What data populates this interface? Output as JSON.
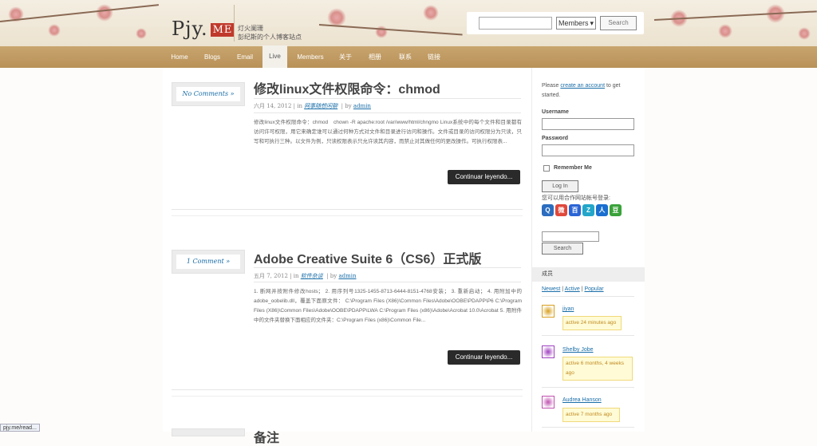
{
  "header": {
    "logo_text": "Pjy.",
    "logo_badge": "ME",
    "slogan_line1": "灯火阑珊",
    "slogan_line2": "彭纪斯的个人博客站点",
    "search_placeholder": "",
    "search_select": "Members",
    "search_button": "Search"
  },
  "nav": {
    "items": [
      {
        "label": "Home",
        "active": false
      },
      {
        "label": "Blogs",
        "active": false
      },
      {
        "label": "Email",
        "active": false
      },
      {
        "label": "Live",
        "active": true
      },
      {
        "label": "Members",
        "active": false
      },
      {
        "label": "关于",
        "active": false
      },
      {
        "label": "相册",
        "active": false
      },
      {
        "label": "联系",
        "active": false
      },
      {
        "label": "链接",
        "active": false
      }
    ]
  },
  "posts": [
    {
      "comments": "No Comments »",
      "title": "修改linux文件权限命令：chmod",
      "date": "六月 14, 2012",
      "category": "网事随想闲聊",
      "author": "admin",
      "excerpt": "修改linux文件权限命令：chmod　chown -R apache:root /var/www/html/chngmo Linux系统中的每个文件和目录都有访问许可权限，用它来确定谁可以通过何种方式对文件和目录进行访问和操作。文件或目录的访问权限分为只读，只写和可执行三种。以文件为例，只读权限表示只允许读其内容，而禁止对其做任何的更改操作。可执行权限表...",
      "more": "Continuar leyendo..."
    },
    {
      "comments": "1 Comment »",
      "title": "Adobe Creative Suite 6（CS6）正式版",
      "date": "五月 7, 2012",
      "category": "软件杂谈",
      "author": "admin",
      "excerpt": "1. 断网并按附件修改hosts； 2. 用序列号1325-1455-8713-6444-8151-4768安装； 3. 重新启动； 4. 用附加中的adobe_oobelib.dll，覆盖下面原文件： C:\\Program Files (X86)\\Common Files\\Adobe\\OOBE\\PDAPP\\P6 C:\\Program Files (X86)\\Common Files\\Adobe\\OOBE\\PDAPP\\LWA C:\\Program Files (x86)\\Adobe\\Acrobat 10.0\\Acrobat 5. 用附件中的文件夹替换下面相应的文件夹：C:\\Program Files (x86)\\Common File...",
      "more": "Continuar leyendo..."
    },
    {
      "comments": "",
      "title": "备注",
      "date": "",
      "category": "",
      "author": "",
      "excerpt": "",
      "more": ""
    }
  ],
  "sidebar": {
    "intro_prefix": "Please",
    "intro_link": "create an account",
    "intro_suffix": "to get started.",
    "username_label": "Username",
    "password_label": "Password",
    "remember_label": "Remember Me",
    "login_button": "Log In",
    "social_text": "您可以用合作网站帐号登录:",
    "socials": [
      {
        "icon": "qq-icon",
        "color": "#2b6dbf",
        "glyph": "Q"
      },
      {
        "icon": "weibo-icon",
        "color": "#e0483c",
        "glyph": "微"
      },
      {
        "icon": "baidu-icon",
        "color": "#2a64d5",
        "glyph": "百"
      },
      {
        "icon": "qzone-icon",
        "color": "#23a6c9",
        "glyph": "Z"
      },
      {
        "icon": "renren-icon",
        "color": "#1a6fd0",
        "glyph": "人"
      },
      {
        "icon": "douban-icon",
        "color": "#3aa23a",
        "glyph": "豆"
      }
    ],
    "search_button": "Search",
    "members_heading": "成员",
    "member_tabs": [
      "Newest",
      "Active",
      "Popular"
    ],
    "members": [
      {
        "name": "jiyan",
        "activity": "active 24 minutes ago",
        "avatar_color": "#d9a020"
      },
      {
        "name": "Shelby Jobe",
        "activity": "active 6 months, 4 weeks ago",
        "avatar_color": "#a040c0"
      },
      {
        "name": "Audrea Hanson",
        "activity": "active 7 months ago",
        "avatar_color": "#c050b0"
      }
    ]
  },
  "status_bar": "pjy.me/read..."
}
